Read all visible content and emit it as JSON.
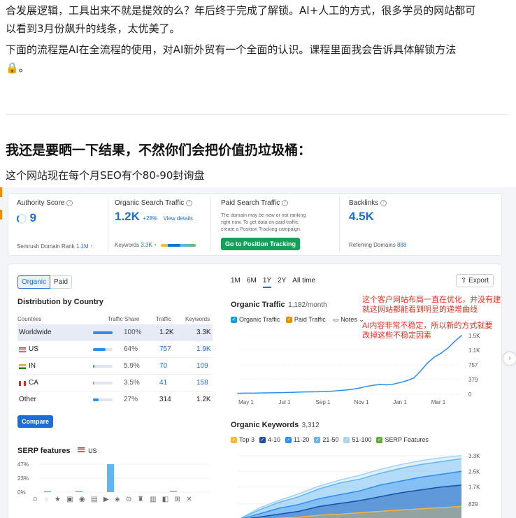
{
  "article": {
    "para1_line1": "合发展逻辑，工具出来不就是提效的么？年后终于完成了解锁。AI+人工的方式，很多学员的网站都可",
    "para1_line2": "以看到3月份飙升的线条，太优美了。",
    "para2_line1": "下面的流程是AI在全流程的使用，对AI新外贸有一个全面的认识。课程里面我会告诉具体解锁方法",
    "para2_lock": "🔒",
    "para2_end": "。",
    "heading": "我还是要晒一下结果，不然你们会把价值扔垃圾桶：",
    "subtext": "这个网站现在每个月SEO有个80-90封询盘"
  },
  "metrics": {
    "authority": {
      "label": "Authority Score",
      "value": "9",
      "footer_label": "Semrush Domain Rank",
      "footer_value": "1.1M ↑"
    },
    "organic": {
      "label": "Organic Search Traffic",
      "value": "1.2K",
      "change": "+28%",
      "link": "View details",
      "footer_label": "Keywords",
      "footer_value": "3.3K ↑"
    },
    "paid": {
      "label": "Paid Search Traffic",
      "desc_line1": "The domain may be new or not ranking",
      "desc_line2": "right now. To get data on paid traffic,",
      "desc_line3": "create a Position Tracking campaign.",
      "button": "Go to Position Tracking"
    },
    "backlinks": {
      "label": "Backlinks",
      "value": "4.5K",
      "footer_label": "Referring Domains",
      "footer_value": "888"
    }
  },
  "distribution": {
    "tab_organic": "Organic",
    "tab_paid": "Paid",
    "title": "Distribution by Country",
    "headers": {
      "country": "Countries",
      "share": "Traffic Share",
      "traffic": "Traffic",
      "keywords": "Keywords"
    },
    "rows": [
      {
        "country": "Worldwide",
        "share": "100%",
        "share_frac": 1.0,
        "traffic": "1.2K",
        "keywords": "3.3K"
      },
      {
        "country": "US",
        "share": "64%",
        "share_frac": 0.64,
        "traffic": "757",
        "keywords": "1.9K"
      },
      {
        "country": "IN",
        "share": "5.9%",
        "share_frac": 0.059,
        "traffic": "70",
        "keywords": "109"
      },
      {
        "country": "CA",
        "share": "3.5%",
        "share_frac": 0.035,
        "traffic": "41",
        "keywords": "158"
      },
      {
        "country": "Other",
        "share": "27%",
        "share_frac": 0.27,
        "traffic": "314",
        "keywords": "1.2K"
      }
    ],
    "compare_button": "Compare"
  },
  "serp": {
    "title": "SERP features",
    "country": "US",
    "y_ticks": [
      "47%",
      "23%",
      "0%"
    ]
  },
  "traffic_panel": {
    "ranges": [
      "1M",
      "6M",
      "1Y",
      "2Y",
      "All time"
    ],
    "active_range": "1Y",
    "export": "Export",
    "title": "Organic Traffic",
    "subtitle": "1,182/month",
    "legend_organic": "Organic Traffic",
    "legend_paid": "Paid Traffic",
    "notes": "Notes"
  },
  "keywords_panel": {
    "title": "Organic Keywords",
    "count": "3,312",
    "legend": [
      "Top 3",
      "4-10",
      "11-20",
      "21-50",
      "51-100",
      "SERP Features"
    ]
  },
  "annotations": {
    "a1_line1": "这个客户网站布局一直在优化，并没有建",
    "a1_line2": "就这网站都能看到明显的递增曲线",
    "a2_line1": "AI内容非常不稳定，所以新的方式就要",
    "a2_line2": "改掉这些不稳定因素"
  },
  "chart_data": [
    {
      "type": "line",
      "title": "Organic Traffic",
      "x_ticks": [
        "May 1",
        "Jul 1",
        "Sep 1",
        "Nov 1",
        "Jan 1",
        "Mar 1"
      ],
      "y_ticks": [
        "1.5K",
        "1.1K",
        "757",
        "379",
        "0"
      ],
      "ylim": [
        0,
        1500
      ],
      "series": [
        {
          "name": "Organic Traffic",
          "values": [
            25,
            28,
            30,
            32,
            35,
            38,
            40,
            45,
            50,
            55,
            60,
            62,
            65,
            70,
            80,
            95,
            110,
            130,
            160,
            200,
            230,
            250,
            240,
            260,
            300,
            350,
            420,
            600,
            800,
            950,
            1050,
            1182,
            1350,
            1500
          ]
        }
      ]
    },
    {
      "type": "area",
      "title": "Organic Keywords",
      "y_ticks": [
        "3.3K",
        "2.5K",
        "1.7K",
        "829"
      ],
      "ylim": [
        0,
        3300
      ],
      "series": [
        {
          "name": "Top 3",
          "values": [
            0,
            50,
            100,
            150,
            250,
            300,
            380,
            450,
            520,
            580,
            640,
            700
          ]
        },
        {
          "name": "4-10",
          "values": [
            0,
            150,
            300,
            450,
            700,
            850,
            1000,
            1200,
            1400,
            1550,
            1700,
            1800
          ]
        },
        {
          "name": "11-20",
          "values": [
            0,
            300,
            600,
            800,
            1100,
            1300,
            1500,
            1800,
            2000,
            2200,
            2350,
            2500
          ]
        },
        {
          "name": "21-50",
          "values": [
            0,
            500,
            900,
            1200,
            1600,
            1900,
            2100,
            2400,
            2650,
            2850,
            3000,
            3150
          ]
        },
        {
          "name": "51-100",
          "values": [
            0,
            600,
            1000,
            1350,
            1750,
            2050,
            2300,
            2600,
            2850,
            3050,
            3200,
            3312
          ]
        }
      ]
    },
    {
      "type": "bar",
      "title": "SERP features",
      "categories": [
        "1",
        "2",
        "3",
        "4",
        "5",
        "6",
        "7",
        "8",
        "9",
        "10",
        "11"
      ],
      "values": [
        1,
        0,
        1,
        0,
        47,
        0,
        0,
        0,
        1,
        0,
        0
      ],
      "ylim": [
        0,
        47
      ]
    }
  ]
}
